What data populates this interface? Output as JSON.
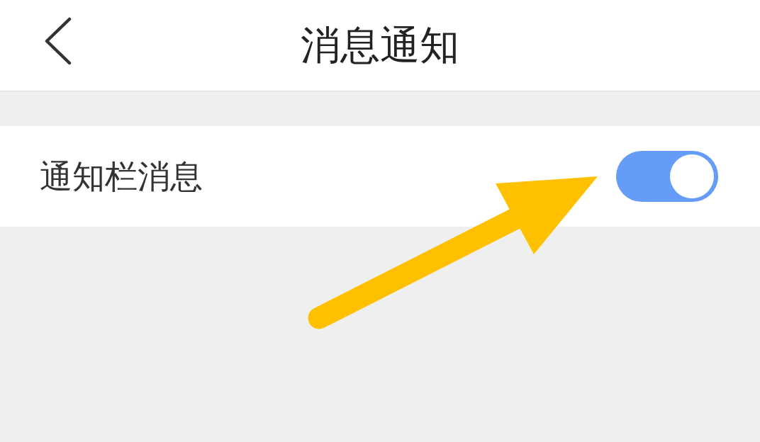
{
  "header": {
    "title": "消息通知"
  },
  "settings": [
    {
      "label": "通知栏消息",
      "on": true
    }
  ],
  "annotation": {
    "kind": "arrow"
  }
}
